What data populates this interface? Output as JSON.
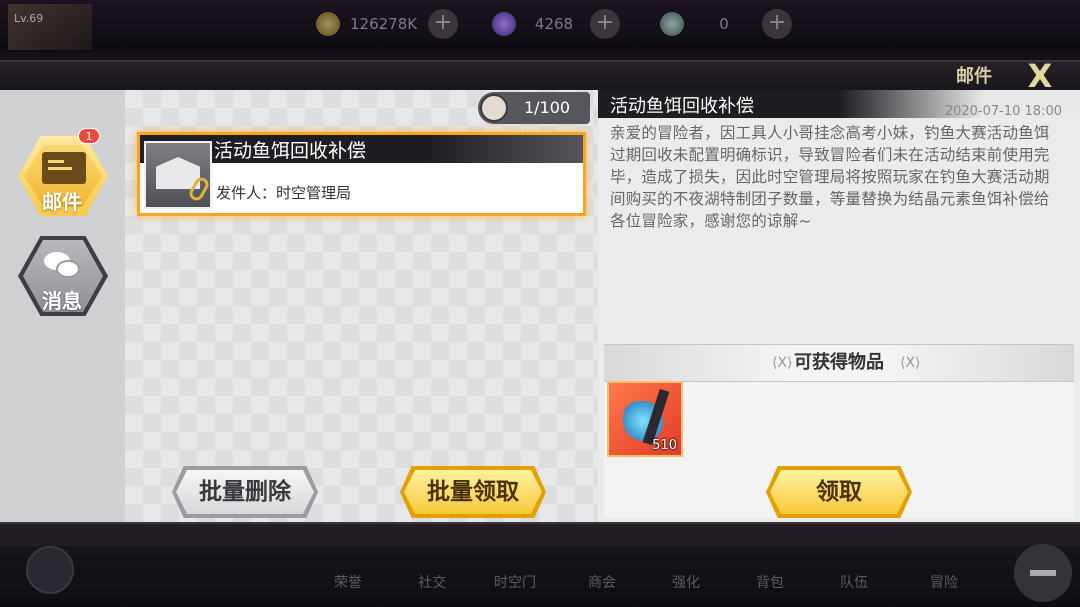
{
  "hud": {
    "level": "Lv.69",
    "gold": "126278K",
    "gems": "4268",
    "tokens": "0",
    "plus": "+"
  },
  "window": {
    "title": "邮件",
    "close": "X"
  },
  "sidebar": {
    "tabs": [
      {
        "label": "邮件",
        "badge": "1"
      },
      {
        "label": "消息"
      }
    ]
  },
  "mail_list": {
    "counter": "1/100",
    "items": [
      {
        "title": "活动鱼饵回收补偿",
        "sender": "发件人：时空管理局"
      }
    ],
    "batch_delete": "批量删除",
    "batch_claim": "批量领取"
  },
  "detail": {
    "title": "活动鱼饵回收补偿",
    "date": "2020-07-10 18:00",
    "body": "亲爱的冒险者，因工具人小哥挂念高考小妹，钓鱼大赛活动鱼饵过期回收未配置明确标识，导致冒险者们未在活动结束前使用完毕，造成了损失，因此时空管理局将按照玩家在钓鱼大赛活动期间购买的不夜湖特制团子数量，等量替换为结晶元素鱼饵补偿给各位冒险家，感谢您的谅解~",
    "rewards_label": "可获得物品",
    "rewards": [
      {
        "name": "结晶元素鱼饵",
        "count": "510"
      }
    ],
    "claim": "领取"
  },
  "bottom_nav": [
    "荣誉",
    "社交",
    "时空门",
    "商会",
    "强化",
    "背包",
    "队伍",
    "冒险"
  ]
}
